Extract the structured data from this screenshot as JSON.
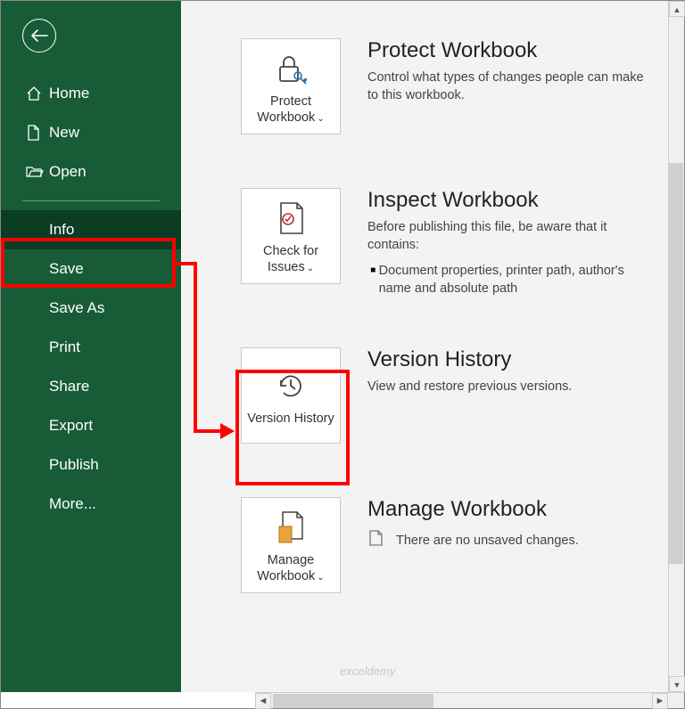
{
  "sidebar": {
    "primary": [
      {
        "label": "Home",
        "icon": "home"
      },
      {
        "label": "New",
        "icon": "document"
      },
      {
        "label": "Open",
        "icon": "folder"
      }
    ],
    "secondary": [
      {
        "label": "Info",
        "active": true
      },
      {
        "label": "Save"
      },
      {
        "label": "Save As"
      },
      {
        "label": "Print"
      },
      {
        "label": "Share"
      },
      {
        "label": "Export"
      },
      {
        "label": "Publish"
      },
      {
        "label": "More..."
      }
    ]
  },
  "sections": {
    "protect": {
      "tile_label": "Protect Workbook",
      "title": "Protect Workbook",
      "desc": "Control what types of changes people can make to this workbook."
    },
    "inspect": {
      "tile_label": "Check for Issues",
      "title": "Inspect Workbook",
      "desc": "Before publishing this file, be aware that it contains:",
      "bullet": "Document properties, printer path, author's name and absolute path"
    },
    "version": {
      "tile_label": "Version History",
      "title": "Version History",
      "desc": "View and restore previous versions."
    },
    "manage": {
      "tile_label": "Manage Workbook",
      "title": "Manage Workbook",
      "desc": "There are no unsaved changes."
    }
  },
  "watermark": "exceldemy",
  "chevron": "⌄"
}
